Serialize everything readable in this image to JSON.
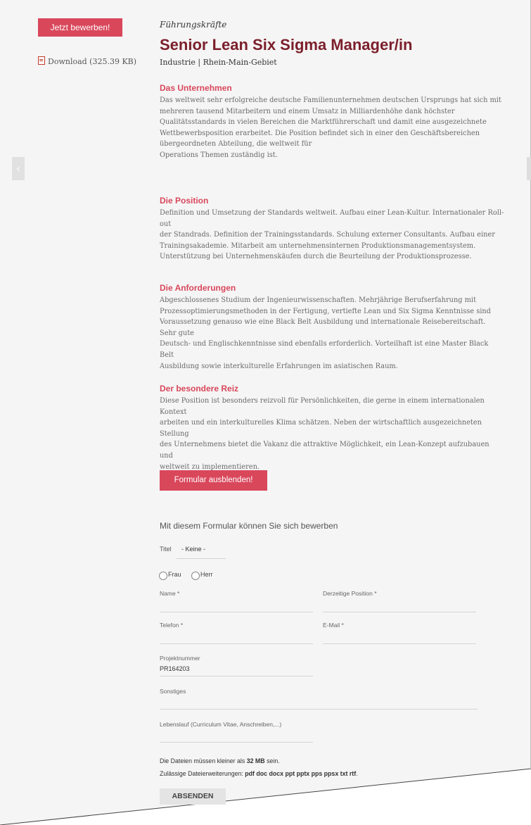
{
  "sidebar": {
    "apply_label": "Jetzt bewerben!",
    "download_label": "Download (325.39 KB)"
  },
  "header": {
    "category": "Führungskräfte",
    "title": "Senior Lean Six Sigma Manager/in",
    "meta": "Industrie | Rhein-Main-Gebiet"
  },
  "sections": [
    {
      "heading": "Das Unternehmen",
      "lines": [
        "Das weltweit sehr erfolgreiche deutsche Familienunternehmen deutschen Ursprungs hat sich mit",
        "mehreren tausend Mitarbeitern und einem Umsatz in Milliardenhöhe dank höchster",
        "Qualitätsstandards in vielen Bereichen die Marktführerschaft und damit eine ausgezeichnete",
        "Wettbewerbsposition erarbeitet. Die Position befindet sich in einer den Geschäftsbereichen",
        "übergeordneten Abteilung, die weltweit für",
        "Operations Themen zuständig ist."
      ]
    },
    {
      "heading": "Die Position",
      "lines": [
        "Definition und Umsetzung der Standards weltweit. Aufbau einer Lean-Kultur. Internationaler Roll-out",
        "der Standrads. Definition der Trainingsstandards.  Schulung externer Consultants. Aufbau einer",
        "Trainingsakademie. Mitarbeit am unternehmensinternen Produktionsmanagementsystem.",
        "Unterstützung bei Unternehmenskäufen durch die Beurteilung der Produktionsprozesse."
      ]
    },
    {
      "heading": "Die Anforderungen",
      "lines": [
        "Abgeschlossenes Studium der Ingenieurwissenschaften. Mehrjährige Berufserfahrung mit",
        "Prozessoptimierungsmethoden in der Fertigung, vertiefte Lean und Six Sigma Kenntnisse sind",
        "Voraussetzung genauso wie eine Black Belt Ausbildung und internationale Reisebereitschaft. Sehr gute",
        "Deutsch- und Englischkenntnisse sind ebenfalls erforderlich. Vorteilhaft ist eine Master Black Belt",
        "Ausbildung sowie interkulturelle Erfahrungen im asiatischen Raum."
      ]
    },
    {
      "heading": "Der besondere Reiz",
      "lines": [
        "Diese Position ist besonders reizvoll für Persönlichkeiten, die gerne in einem internationalen Kontext",
        "arbeiten und ein interkulturelles Klima schätzen. Neben der wirtschaftlich ausgezeichneten Stellung",
        "des Unternehmens bietet die Vakanz die attraktive Möglichkeit, ein Lean-Konzept aufzubauen und",
        "weltweit zu implementieren."
      ]
    }
  ],
  "form": {
    "toggle_label": "Formular ausblenden!",
    "intro": "Mit diesem Formular können Sie sich bewerben",
    "title_label": "Titel",
    "title_value": "- Keine -",
    "radio_frau": "Frau",
    "radio_herr": "Herr",
    "name_label": "Name *",
    "position_label": "Derzeitige Position *",
    "phone_label": "Telefon *",
    "email_label": "E-Mail *",
    "project_label": "Projektnummer",
    "project_value": "PR164203",
    "misc_label": "Sonstiges",
    "cv_label": "Lebenslauf (Curriculum Vitae, Anschreiben,...)",
    "size_prefix": "Die Dateien müssen kleiner als ",
    "size_value": "32 MB",
    "size_suffix": " sein.",
    "ext_prefix": "Zulässige Dateierweiterungen: ",
    "ext_value": "pdf doc docx ppt pptx pps ppsx txt rtf",
    "ext_suffix": ".",
    "submit_label": "ABSENDEN"
  }
}
